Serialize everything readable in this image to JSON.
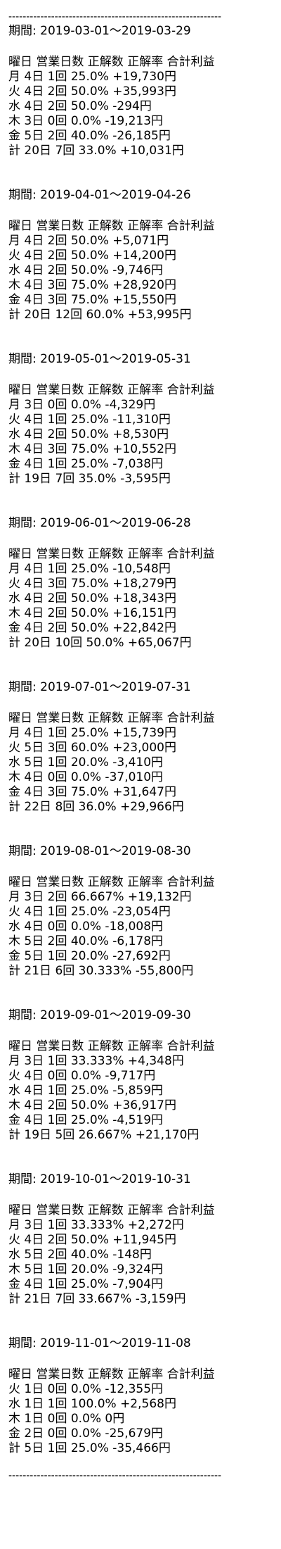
{
  "divider": "------------------------------------------------------------",
  "header": "曜日 営業日数 正解数 正解率 合計利益",
  "period_prefix": "期間: ",
  "periods": [
    {
      "range": "2019-03-01～2019-03-29",
      "rows": [
        "月 4日 1回 25.0% +19,730円",
        "火 4日 2回 50.0% +35,993円",
        "水 4日 2回 50.0% -294円",
        "木 3日 0回 0.0% -19,213円",
        "金 5日 2回 40.0% -26,185円",
        "計 20日 7回 33.0% +10,031円"
      ]
    },
    {
      "range": "2019-04-01～2019-04-26",
      "rows": [
        "月 4日 2回 50.0% +5,071円",
        "火 4日 2回 50.0% +14,200円",
        "水 4日 2回 50.0% -9,746円",
        "木 4日 3回 75.0% +28,920円",
        "金 4日 3回 75.0% +15,550円",
        "計 20日 12回 60.0% +53,995円"
      ]
    },
    {
      "range": "2019-05-01～2019-05-31",
      "rows": [
        "月 3日 0回 0.0% -4,329円",
        "火 4日 1回 25.0% -11,310円",
        "水 4日 2回 50.0% +8,530円",
        "木 4日 3回 75.0% +10,552円",
        "金 4日 1回 25.0% -7,038円",
        "計 19日 7回 35.0% -3,595円"
      ]
    },
    {
      "range": "2019-06-01～2019-06-28",
      "rows": [
        "月 4日 1回 25.0% -10,548円",
        "火 4日 3回 75.0% +18,279円",
        "水 4日 2回 50.0% +18,343円",
        "木 4日 2回 50.0% +16,151円",
        "金 4日 2回 50.0% +22,842円",
        "計 20日 10回 50.0% +65,067円"
      ]
    },
    {
      "range": "2019-07-01～2019-07-31",
      "rows": [
        "月 4日 1回 25.0% +15,739円",
        "火 5日 3回 60.0% +23,000円",
        "水 5日 1回 20.0% -3,410円",
        "木 4日 0回 0.0% -37,010円",
        "金 4日 3回 75.0% +31,647円",
        "計 22日 8回 36.0% +29,966円"
      ]
    },
    {
      "range": "2019-08-01～2019-08-30",
      "rows": [
        "月 3日 2回 66.667% +19,132円",
        "火 4日 1回 25.0% -23,054円",
        "水 4日 0回 0.0% -18,008円",
        "木 5日 2回 40.0% -6,178円",
        "金 5日 1回 20.0% -27,692円",
        "計 21日 6回 30.333% -55,800円"
      ]
    },
    {
      "range": "2019-09-01～2019-09-30",
      "rows": [
        "月 3日 1回 33.333% +4,348円",
        "火 4日 0回 0.0% -9,717円",
        "水 4日 1回 25.0% -5,859円",
        "木 4日 2回 50.0% +36,917円",
        "金 4日 1回 25.0% -4,519円",
        "計 19日 5回 26.667% +21,170円"
      ]
    },
    {
      "range": "2019-10-01～2019-10-31",
      "rows": [
        "月 3日 1回 33.333% +2,272円",
        "火 4日 2回 50.0% +11,945円",
        "水 5日 2回 40.0% -148円",
        "木 5日 1回 20.0% -9,324円",
        "金 4日 1回 25.0% -7,904円",
        "計 21日 7回 33.667% -3,159円"
      ]
    },
    {
      "range": "2019-11-01～2019-11-08",
      "rows": [
        "火 1日 0回 0.0% -12,355円",
        "水 1日 1回 100.0% +2,568円",
        "木 1日 0回 0.0% 0円",
        "金 2日 0回 0.0% -25,679円",
        "計 5日 1回 25.0% -35,466円"
      ]
    }
  ]
}
